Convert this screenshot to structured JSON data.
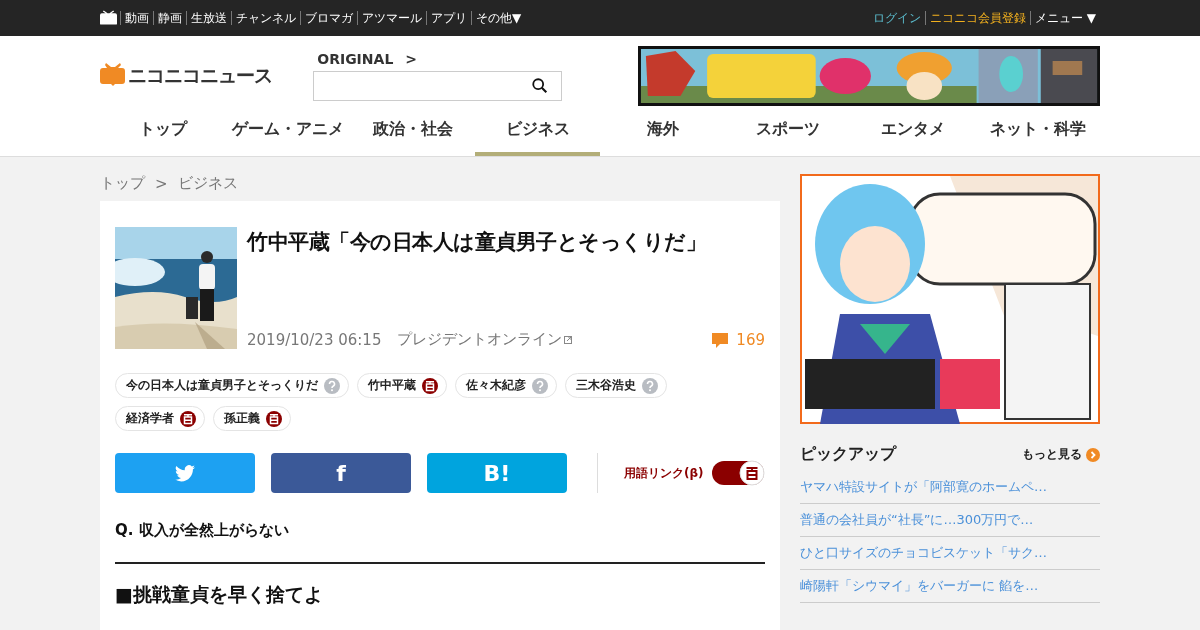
{
  "top_bar": {
    "links": [
      "動画",
      "静画",
      "生放送",
      "チャンネル",
      "ブロマガ",
      "アツマール",
      "アプリ",
      "その他▼"
    ],
    "right": [
      {
        "label": "ログイン",
        "kind": "login"
      },
      {
        "label": "ニコニコ会員登録",
        "kind": "register"
      },
      {
        "label": "メニュー ▼",
        "kind": "menu"
      }
    ]
  },
  "header": {
    "logo": "ニコニコニュース",
    "original_link": "ORIGINAL",
    "original_arrow": ">"
  },
  "nav": [
    {
      "label": "トップ",
      "selected": false
    },
    {
      "label": "ゲーム・アニメ",
      "selected": false
    },
    {
      "label": "政治・社会",
      "selected": false
    },
    {
      "label": "ビジネス",
      "selected": true
    },
    {
      "label": "海外",
      "selected": false
    },
    {
      "label": "スポーツ",
      "selected": false
    },
    {
      "label": "エンタメ",
      "selected": false
    },
    {
      "label": "ネット・科学",
      "selected": false
    }
  ],
  "breadcrumb": [
    "トップ",
    ">",
    "ビジネス"
  ],
  "article": {
    "title": "竹中平蔵「今の日本人は童貞男子とそっくりだ」",
    "date": "2019/10/23 06:15",
    "source": "プレジデントオンライン",
    "comments": "169",
    "tags": [
      {
        "label": "今の日本人は童貞男子とそっくりだ",
        "kind": "unknown"
      },
      {
        "label": "竹中平蔵",
        "kind": "dictionary"
      },
      {
        "label": "佐々木紀彦",
        "kind": "unknown"
      },
      {
        "label": "三木谷浩史",
        "kind": "unknown"
      },
      {
        "label": "経済学者",
        "kind": "dictionary"
      },
      {
        "label": "孫正義",
        "kind": "dictionary"
      }
    ],
    "share": [
      {
        "kind": "twitter"
      },
      {
        "kind": "facebook",
        "label": "f"
      },
      {
        "kind": "hatena",
        "label": "B!"
      }
    ],
    "term_link": {
      "label": "用語リンク(β)",
      "on": true
    },
    "question": "Q. 収入が全然上がらない",
    "heading": "■挑戦童貞を早く捨てよ"
  },
  "sidebar": {
    "pickup": {
      "title": "ピックアップ",
      "more": "もっと見る",
      "items": [
        "ヤマハ特設サイトが「阿部寛のホームペ…",
        "普通の会社員が“社長”に…300万円で…",
        "ひと口サイズのチョコビスケット「サク…",
        "崎陽軒「シウマイ」をバーガーに 餡を…"
      ]
    }
  }
}
